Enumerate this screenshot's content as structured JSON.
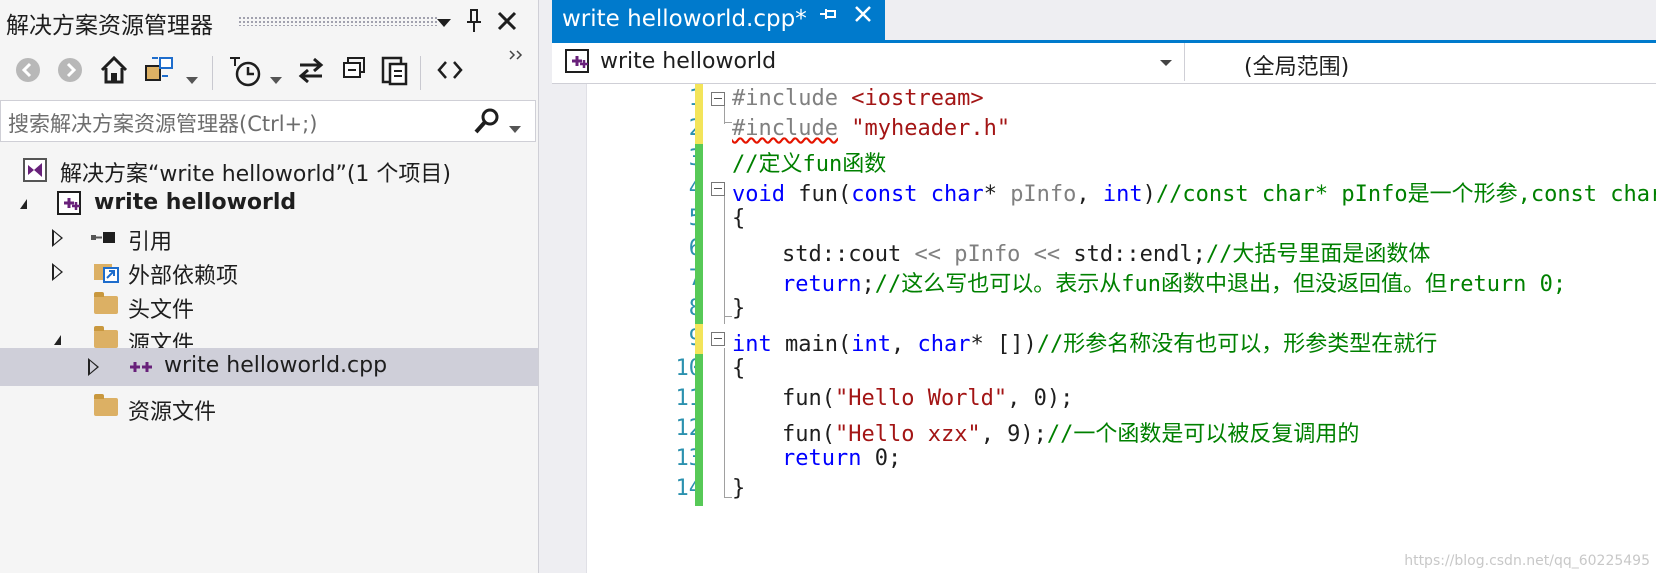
{
  "solution_explorer": {
    "title": "解决方案资源管理器",
    "search_placeholder": "搜索解决方案资源管理器(Ctrl+;)",
    "toolbar_icons": [
      "back-icon",
      "forward-icon",
      "home-icon",
      "sync-switch-icon",
      "dropdown-arrow-icon",
      "pending-changes-icon",
      "dropdown-arrow-icon",
      "sync-icon",
      "collapse-all-icon",
      "copy-icon",
      "view-code-icon"
    ],
    "tree": [
      {
        "label": "解决方案“write helloworld”(1 个项目)",
        "icon": "solution-icon"
      },
      {
        "label": "write helloworld",
        "icon": "cpp-project-icon",
        "bold": true
      },
      {
        "label": "引用",
        "icon": "references-icon"
      },
      {
        "label": "外部依赖项",
        "icon": "external-deps-icon"
      },
      {
        "label": "头文件",
        "icon": "folder-icon"
      },
      {
        "label": "源文件",
        "icon": "folder-icon"
      },
      {
        "label": "write helloworld.cpp",
        "icon": "cpp-file-icon",
        "selected": true
      },
      {
        "label": "资源文件",
        "icon": "folder-icon"
      }
    ]
  },
  "editor": {
    "tab_title": "write helloworld.cpp*",
    "nav_project": "write helloworld",
    "nav_scope": "(全局范围)",
    "line_numbers": [
      "1",
      "2",
      "3",
      "4",
      "5",
      "6",
      "7",
      "8",
      "9",
      "10",
      "11",
      "12",
      "13",
      "14"
    ],
    "lines": [
      {
        "t": "pp",
        "v": "#include "
      },
      {
        "t": "str",
        "v": "<iostream>"
      },
      {
        "t": "pp",
        "v": "#include",
        "sq": true
      },
      {
        "t": "str",
        "v": "\"myheader.h\""
      },
      {
        "t": "cm",
        "v": "//定义fun函数"
      },
      {
        "t": "kw",
        "v": "void"
      },
      {
        "t": "plain",
        "v": " fun("
      },
      {
        "t": "kw",
        "v": "const"
      },
      {
        "t": "plain",
        "v": " "
      },
      {
        "t": "kw",
        "v": "char"
      },
      {
        "t": "plain",
        "v": "* "
      },
      {
        "t": "ph",
        "v": "pInfo"
      },
      {
        "t": "plain",
        "v": ", "
      },
      {
        "t": "kw",
        "v": "int"
      },
      {
        "t": "plain",
        "v": ")"
      },
      {
        "t": "cm",
        "v": "//const char* pInfo是一个形参,const char"
      },
      {
        "t": "plain",
        "v": "{"
      },
      {
        "t": "plain",
        "v": "std::cout "
      },
      {
        "t": "ph",
        "v": "<<"
      },
      {
        "t": "plain",
        "v": " "
      },
      {
        "t": "ph",
        "v": "pInfo"
      },
      {
        "t": "plain",
        "v": " "
      },
      {
        "t": "ph",
        "v": "<<"
      },
      {
        "t": "plain",
        "v": " std::endl;"
      },
      {
        "t": "cm",
        "v": "//大括号里面是函数体"
      },
      {
        "t": "kw",
        "v": "return"
      },
      {
        "t": "plain",
        "v": ";"
      },
      {
        "t": "cm",
        "v": "//这么写也可以。表示从fun函数中退出，但没返回值。但return 0;"
      },
      {
        "t": "plain",
        "v": "}"
      },
      {
        "t": "kw",
        "v": "int"
      },
      {
        "t": "plain",
        "v": " main("
      },
      {
        "t": "kw",
        "v": "int"
      },
      {
        "t": "plain",
        "v": ", "
      },
      {
        "t": "kw",
        "v": "char"
      },
      {
        "t": "plain",
        "v": "* [])"
      },
      {
        "t": "cm",
        "v": "//形参名称没有也可以，形参类型在就行"
      },
      {
        "t": "plain",
        "v": "{"
      },
      {
        "t": "plain",
        "v": "fun("
      },
      {
        "t": "str",
        "v": "\"Hello World\""
      },
      {
        "t": "plain",
        "v": ", 0);"
      },
      {
        "t": "plain",
        "v": "fun("
      },
      {
        "t": "str",
        "v": "\"Hello xzx\""
      },
      {
        "t": "plain",
        "v": ", 9);"
      },
      {
        "t": "cm",
        "v": "//一个函数是可以被反复调用的"
      },
      {
        "t": "kw",
        "v": "return"
      },
      {
        "t": "plain",
        "v": " 0;"
      },
      {
        "t": "plain",
        "v": "}"
      }
    ]
  },
  "colors": {
    "accent": "#007acc",
    "keyword": "#0000ff",
    "string": "#a31515",
    "comment": "#008000",
    "line_number": "#2b91af",
    "change_saved": "#57c957",
    "change_unsaved": "#f3e45a"
  },
  "watermark": "https://blog.csdn.net/qq_60225495"
}
